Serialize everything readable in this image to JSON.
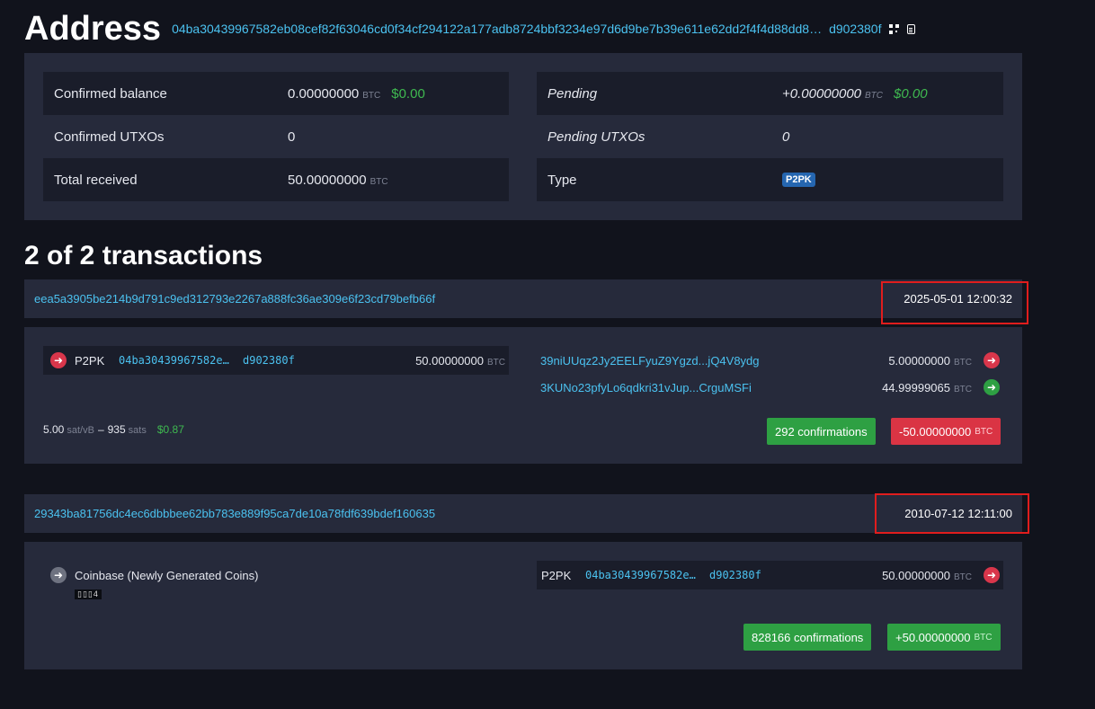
{
  "page": {
    "title": "Address",
    "address_full": "04ba30439967582eb08cef82f63046cd0f34cf294122a177adb8724bbf3234e97d6d9be7b39e611e62dd2f4f4d88dd8…",
    "address_tail": "d902380f"
  },
  "info": {
    "confirmed_balance_label": "Confirmed balance",
    "confirmed_balance_value": "0.00000000",
    "confirmed_balance_unit": "BTC",
    "confirmed_balance_usd": "$0.00",
    "pending_label": "Pending",
    "pending_value": "+0.00000000",
    "pending_unit": "BTC",
    "pending_usd": "$0.00",
    "confirmed_utxos_label": "Confirmed UTXOs",
    "confirmed_utxos_value": "0",
    "pending_utxos_label": "Pending UTXOs",
    "pending_utxos_value": "0",
    "total_received_label": "Total received",
    "total_received_value": "50.00000000",
    "total_received_unit": "BTC",
    "type_label": "Type",
    "type_value": "P2PK"
  },
  "transactions_heading": "2 of 2 transactions",
  "tx1": {
    "hash": "eea5a3905be214b9d791c9ed312793e2267a888fc36ae309e6f23cd79befb66f",
    "time": "2025-05-01 12:00:32",
    "input": {
      "type": "P2PK",
      "address_head": "04ba30439967582e…",
      "address_tail": "d902380f",
      "amount": "50.00000000",
      "unit": "BTC"
    },
    "outputs": [
      {
        "address": "39niUUqz2Jy2EELFyuZ9Ygzd...jQ4V8ydg",
        "amount": "5.00000000",
        "unit": "BTC",
        "status": "spent"
      },
      {
        "address": "3KUNo23pfyLo6qdkri31vJup...CrguMSFi",
        "amount": "44.99999065",
        "unit": "BTC",
        "status": "unspent"
      }
    ],
    "fee_rate": "5.00",
    "fee_rate_unit": "sat/vB",
    "fee_sep": "–",
    "fee_sats": "935",
    "fee_sats_unit": "sats",
    "fee_usd": "$0.87",
    "confirmations": "292 confirmations",
    "delta": "-50.00000000",
    "delta_unit": "BTC"
  },
  "tx2": {
    "hash": "29343ba81756dc4ec6dbbbee62bb783e889f95ca7de10a78fdf639bdef160635",
    "time": "2010-07-12 12:11:00",
    "input_label": "Coinbase (Newly Generated Coins)",
    "input_badge": "▯▯▯4",
    "output": {
      "type": "P2PK",
      "address_head": "04ba30439967582e…",
      "address_tail": "d902380f",
      "amount": "50.00000000",
      "unit": "BTC"
    },
    "confirmations": "828166 confirmations",
    "delta": "+50.00000000",
    "delta_unit": "BTC"
  },
  "colors": {
    "background": "#11131c",
    "panel": "#262a3b",
    "panel_dark": "#1a1d2a",
    "link": "#4bc2f0",
    "green": "#2ea043",
    "red": "#da3444",
    "highlight_box": "#e01d1d"
  },
  "icons": {
    "qr": "qr-code-icon",
    "copy": "copy-icon",
    "arrow": "arrow-right-icon"
  }
}
